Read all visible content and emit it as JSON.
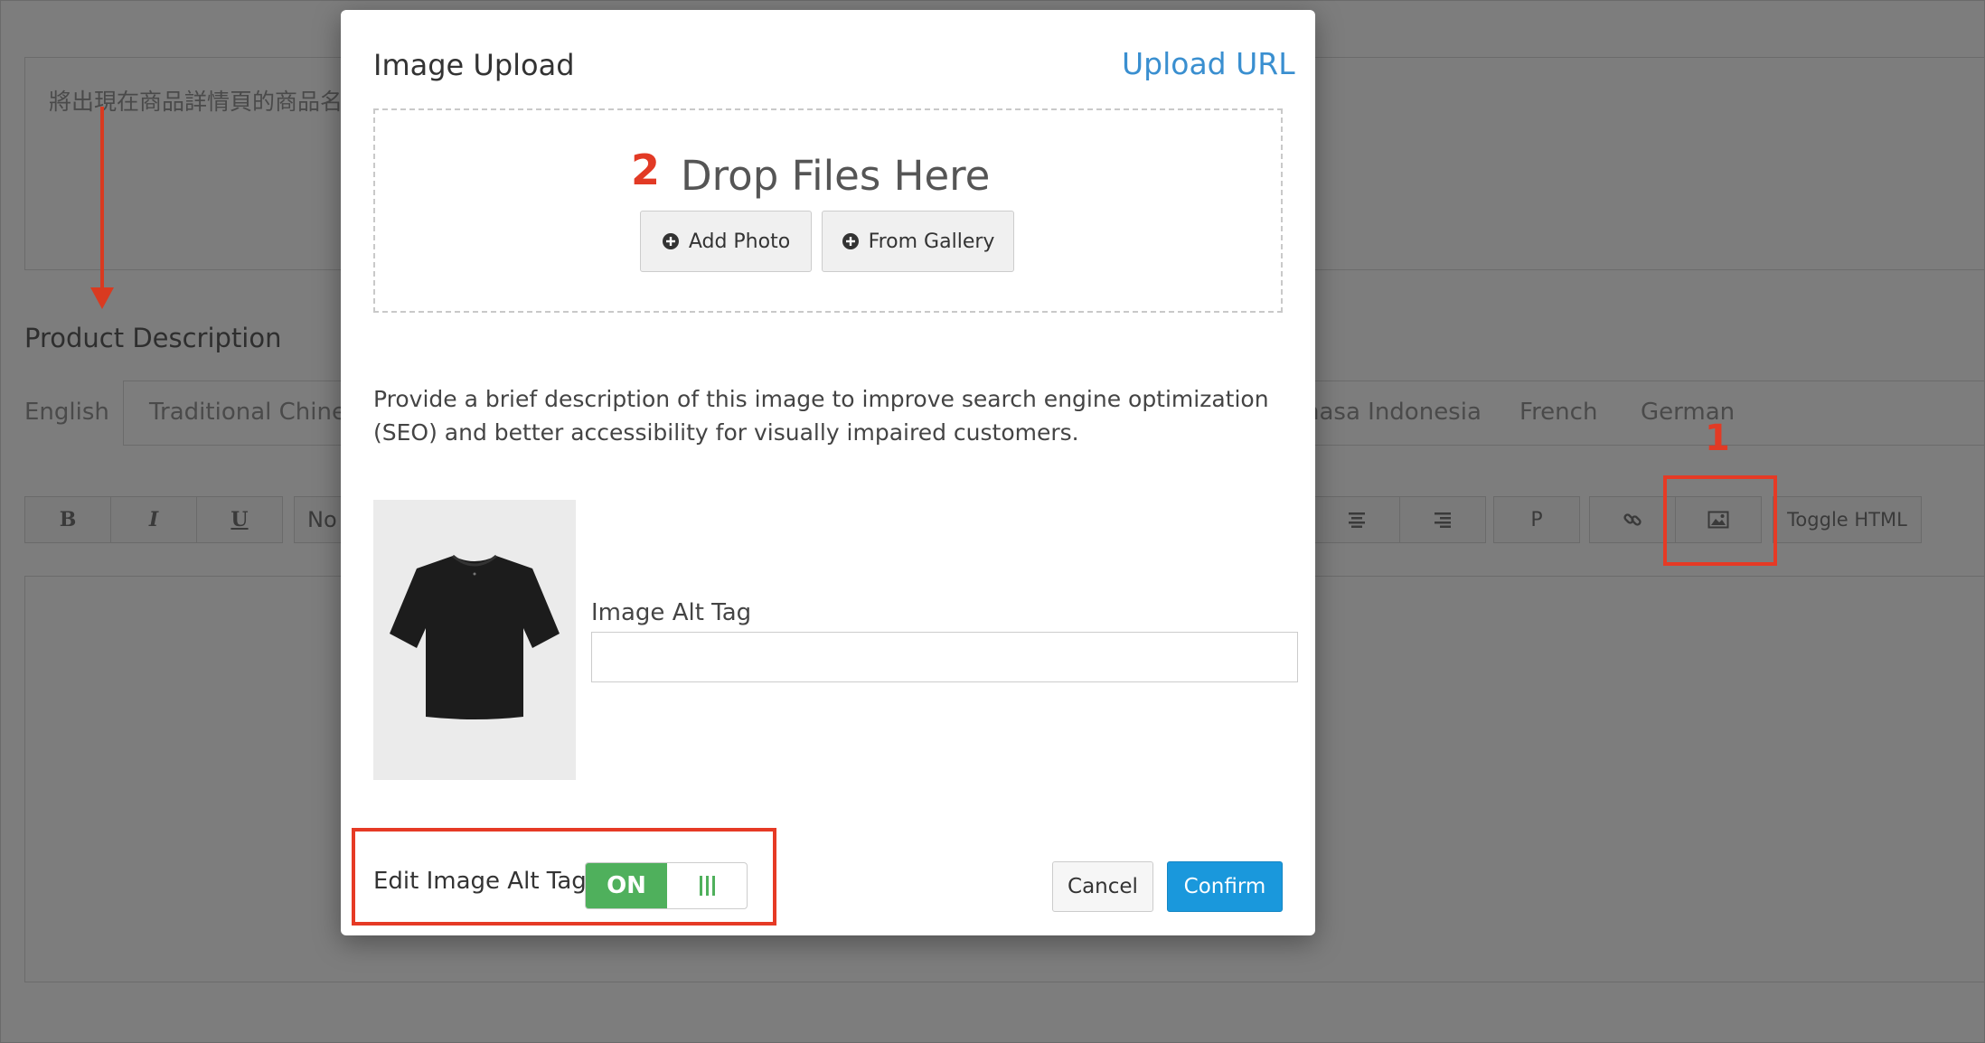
{
  "background": {
    "product_name_placeholder": "將出現在商品詳情頁的商品名",
    "description_label": "Product Description",
    "tabs": [
      "English",
      "Traditional Chines",
      "hasa Indonesia",
      "French",
      "German"
    ],
    "toolbar": {
      "bold": "B",
      "italic": "I",
      "underline": "U",
      "format_select": "No",
      "paragraph": "P",
      "toggle_html": "Toggle HTML"
    }
  },
  "annotations": {
    "step1": "1",
    "step2": "2"
  },
  "modal": {
    "title": "Image Upload",
    "upload_url_link": "Upload URL",
    "drop_text": "Drop Files Here",
    "add_photo_label": "Add Photo",
    "from_gallery_label": "From Gallery",
    "seo_text": "Provide a brief description of this image to improve search engine optimization (SEO) and better accessibility for visually impaired customers.",
    "alt_tag_label": "Image Alt Tag",
    "alt_tag_value": "",
    "edit_alt_label": "Edit Image Alt Tag",
    "toggle_state": "ON",
    "cancel_label": "Cancel",
    "confirm_label": "Confirm"
  },
  "colors": {
    "accent_blue": "#1a98dc",
    "link_blue": "#3a8fd0",
    "toggle_green": "#4fb05c",
    "annotation_red": "#e63a25"
  }
}
